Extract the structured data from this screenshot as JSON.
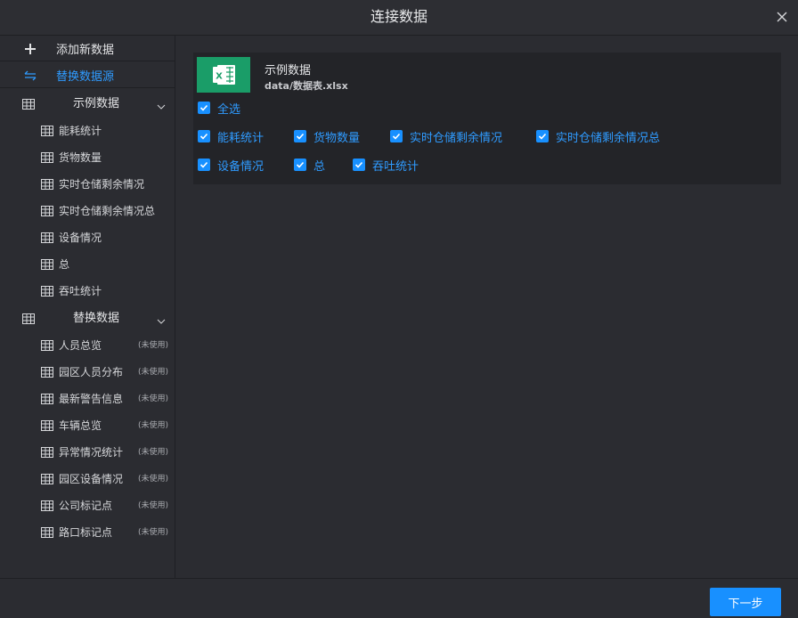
{
  "dialog": {
    "title": "连接数据",
    "close_icon": "close-icon"
  },
  "sidebar": {
    "add_label": "添加新数据",
    "replace_label": "替换数据源",
    "groups": [
      {
        "label": "示例数据",
        "items": [
          {
            "label": "能耗统计"
          },
          {
            "label": "货物数量"
          },
          {
            "label": "实时仓储剩余情况"
          },
          {
            "label": "实时仓储剩余情况总"
          },
          {
            "label": "设备情况"
          },
          {
            "label": "总"
          },
          {
            "label": "吞吐统计"
          }
        ]
      },
      {
        "label": "替换数据",
        "items": [
          {
            "label": "人员总览",
            "status": "(未使用)"
          },
          {
            "label": "园区人员分布",
            "status": "(未使用)"
          },
          {
            "label": "最新警告信息",
            "status": "(未使用)"
          },
          {
            "label": "车辆总览",
            "status": "(未使用)"
          },
          {
            "label": "异常情况统计",
            "status": "(未使用)"
          },
          {
            "label": "园区设备情况",
            "status": "(未使用)"
          },
          {
            "label": "公司标记点",
            "status": "(未使用)"
          },
          {
            "label": "路口标记点",
            "status": "(未使用)"
          }
        ]
      }
    ]
  },
  "main": {
    "source_name": "示例数据",
    "source_path": "data/数据表.xlsx",
    "select_all_label": "全选",
    "sheets": [
      {
        "label": "能耗统计",
        "checked": true
      },
      {
        "label": "货物数量",
        "checked": true
      },
      {
        "label": "实时仓储剩余情况",
        "checked": true
      },
      {
        "label": "实时仓储剩余情况总",
        "checked": true
      },
      {
        "label": "设备情况",
        "checked": true
      },
      {
        "label": "总",
        "checked": true
      },
      {
        "label": "吞吐统计",
        "checked": true
      }
    ]
  },
  "footer": {
    "next_label": "下一步"
  },
  "colors": {
    "accent": "#1890ff",
    "excel_green": "#1a9d68",
    "background": "#2b2c31"
  }
}
